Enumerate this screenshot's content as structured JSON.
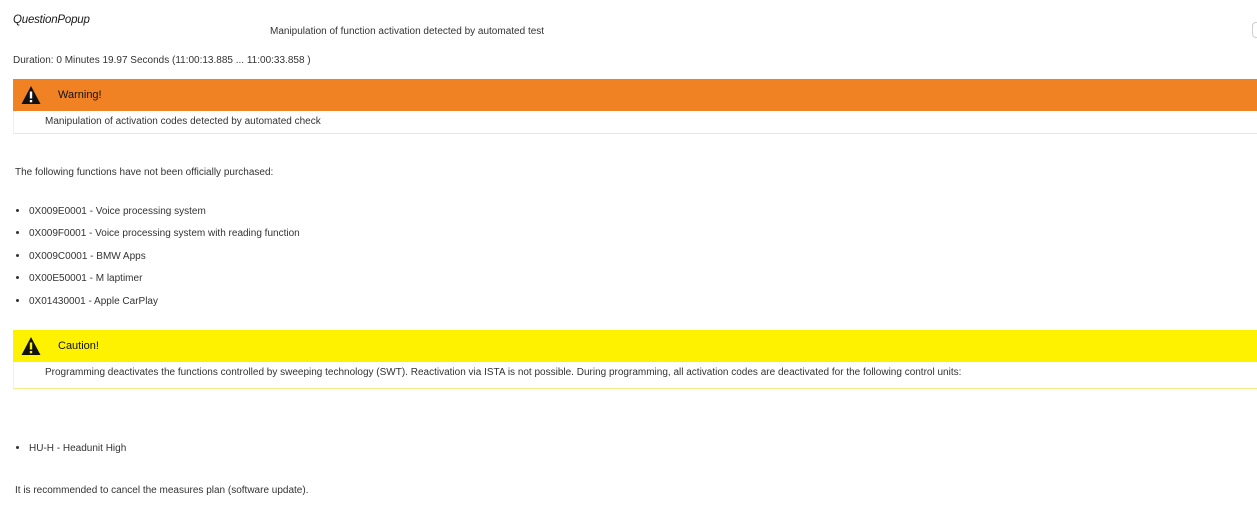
{
  "dialog": {
    "title": "QuestionPopup",
    "message": "Manipulation of function activation detected by automated test",
    "duration": "Duration: 0 Minutes 19.97 Seconds (11:00:13.885 ... 11:00:33.858 )"
  },
  "warning_box": {
    "icon": "warning-triangle-icon",
    "title": "Warning!",
    "text": "Manipulation of activation codes detected by automated check",
    "color": "#f08223"
  },
  "functions": {
    "intro": "The following functions have not been officially purchased:",
    "items": [
      "0X009E0001 - Voice processing system",
      "0X009F0001 - Voice processing system with reading function",
      "0X009C0001 - BMW Apps",
      "0X00E50001 - M laptimer",
      "0X01430001 - Apple CarPlay"
    ]
  },
  "caution_box": {
    "icon": "warning-triangle-icon",
    "title": "Caution!",
    "text": "Programming deactivates the functions controlled by sweeping technology (SWT). Reactivation via ISTA is not possible. During programming, all activation codes are deactivated for the following control units:",
    "color": "#fff200"
  },
  "control_units": {
    "items": [
      "HU-H - Headunit High"
    ]
  },
  "recommendation": "It is recommended to cancel the measures plan (software update)."
}
